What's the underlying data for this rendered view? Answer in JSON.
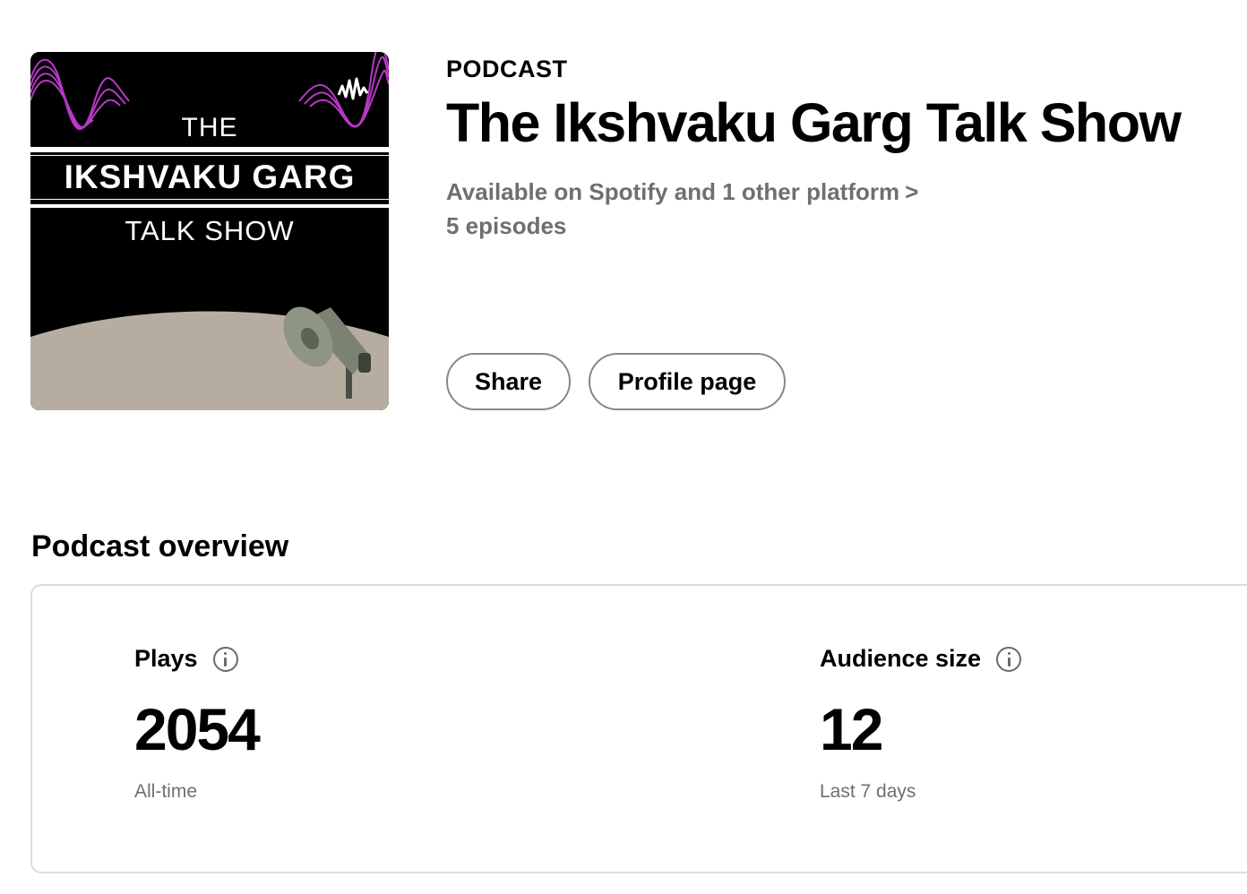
{
  "cover": {
    "line1": "THE",
    "line2": "IKSHVAKU GARG",
    "line3": "TALK SHOW",
    "icon": "megaphone-icon",
    "colors": {
      "background": "#000000",
      "wave": "#c13bd0",
      "ground": "#b6ada0"
    }
  },
  "header": {
    "kicker": "PODCAST",
    "title": "The Ikshvaku Garg Talk Show",
    "availability": "Available on Spotify and 1 other platform",
    "availability_chevron": ">",
    "episodes": "5 episodes"
  },
  "actions": {
    "share_label": "Share",
    "profile_label": "Profile page"
  },
  "overview": {
    "title": "Podcast overview",
    "metrics": [
      {
        "label": "Plays",
        "value": "2054",
        "sub": "All-time",
        "icon": "info-icon"
      },
      {
        "label": "Audience size",
        "value": "12",
        "sub": "Last 7 days",
        "icon": "info-icon"
      }
    ]
  }
}
